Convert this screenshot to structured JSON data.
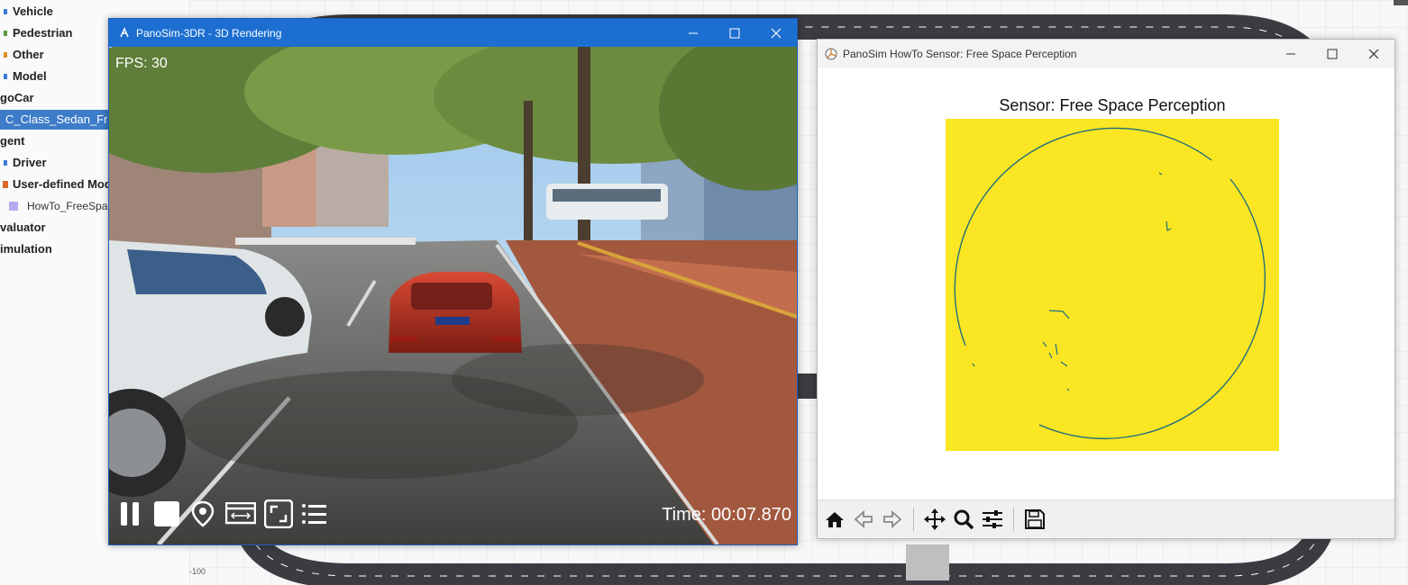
{
  "tree": {
    "items": [
      {
        "label": "Vehicle"
      },
      {
        "label": "Pedestrian"
      },
      {
        "label": "Other"
      },
      {
        "label": "Model"
      },
      {
        "label": "goCar"
      },
      {
        "label": "C_Class_Sedan_Free"
      },
      {
        "label": "gent"
      },
      {
        "label": "Driver"
      },
      {
        "label": "User-defined Mod"
      },
      {
        "label": "HowTo_FreeSpac"
      },
      {
        "label": "valuator"
      },
      {
        "label": "imulation"
      }
    ]
  },
  "canvas": {
    "axis_label": "-100"
  },
  "render_window": {
    "title": "PanoSim-3DR - 3D Rendering",
    "fps": "FPS: 30",
    "time": "Time: 00:07.870",
    "controls": [
      "pause-icon",
      "stop-icon",
      "location-icon",
      "swap-view-icon",
      "fullscreen-icon",
      "list-icon"
    ]
  },
  "plot_window": {
    "title": "PanoSim HowTo Sensor: Free Space Perception",
    "plot_title": "Sensor: Free Space Perception",
    "colors": {
      "background": "#fbe623",
      "boundary": "#1f6e7a"
    },
    "toolbar": [
      "home-icon",
      "back-icon",
      "forward-icon",
      "pan-icon",
      "zoom-icon",
      "configure-icon",
      "save-icon"
    ]
  }
}
